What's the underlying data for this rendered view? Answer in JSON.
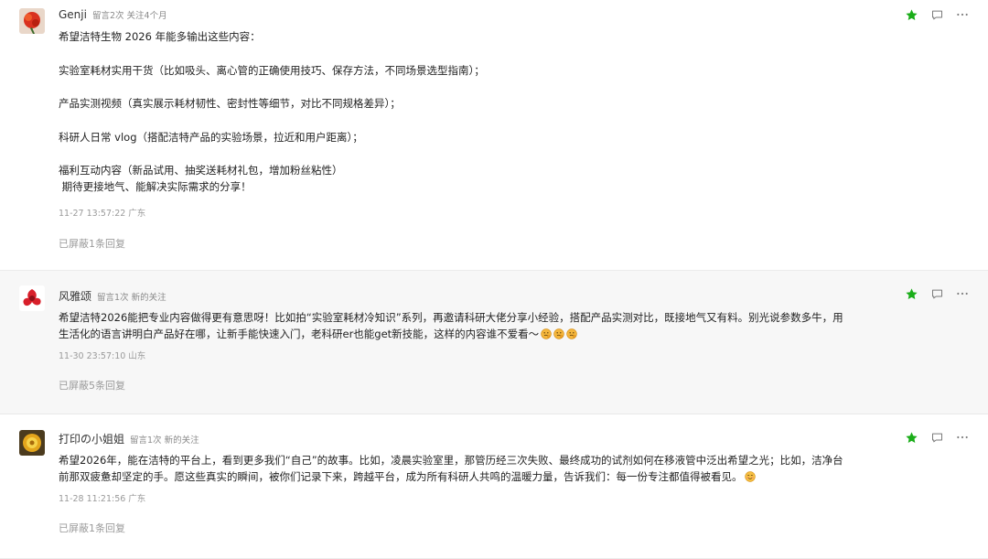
{
  "colors": {
    "star": "#1aad19",
    "icon": "#7a7a7a",
    "alt_bg": "#f7f7f7"
  },
  "comments": [
    {
      "name": "Genji",
      "meta": "留言2次 关注4个月",
      "paragraphs": [
        "希望洁特生物 2026 年能多输出这些内容：",
        "实验室耗材实用干货（比如吸头、离心管的正确使用技巧、保存方法，不同场景选型指南）；",
        "产品实测视频（真实展示耗材韧性、密封性等细节，对比不同规格差异）；",
        "科研人日常 vlog（搭配洁特产品的实验场景，拉近和用户距离）；",
        "福利互动内容（新品试用、抽奖送耗材礼包，增加粉丝粘性）",
        " 期待更接地气、能解决实际需求的分享！"
      ],
      "time": "11-27 13:57:22 广东",
      "hidden": "已屏蔽1条回复",
      "icons": [
        "star-icon",
        "comment-icon",
        "more-icon"
      ]
    },
    {
      "name": "风雅颂",
      "meta": "留言1次 新的关注",
      "line1": "希望洁特2026能把专业内容做得更有意思呀！比如拍“实验室耗材冷知识”系列，再邀请科研大佬分享小经验，搭配产品实测对比，既接地气又有料。别光说参数多牛，用",
      "line2": "生活化的语言讲明白产品好在哪，让新手能快速入门，老科研er也能get新技能，这样的内容谁不爱看～",
      "emojis": [
        "thinking-emoji",
        "thinking-emoji",
        "thinking-emoji"
      ],
      "time": "11-30 23:57:10 山东",
      "hidden": "已屏蔽5条回复",
      "icons": [
        "star-icon",
        "comment-icon",
        "more-icon"
      ]
    },
    {
      "name": "打印の小姐姐",
      "meta": "留言1次 新的关注",
      "line1": "希望2026年，能在洁特的平台上，看到更多我们“自己”的故事。比如，凌晨实验室里，那管历经三次失败、最终成功的试剂如何在移液管中泛出希望之光；比如，洁净台",
      "line2": "前那双疲惫却坚定的手。愿这些真实的瞬间，被你们记录下来，跨越平台，成为所有科研人共鸣的温暖力量，告诉我们：每一份专注都值得被看见。",
      "emojis": [
        "smile-emoji"
      ],
      "time": "11-28 11:21:56 广东",
      "hidden": "已屏蔽1条回复",
      "icons": [
        "star-icon",
        "comment-icon",
        "more-icon"
      ]
    }
  ]
}
